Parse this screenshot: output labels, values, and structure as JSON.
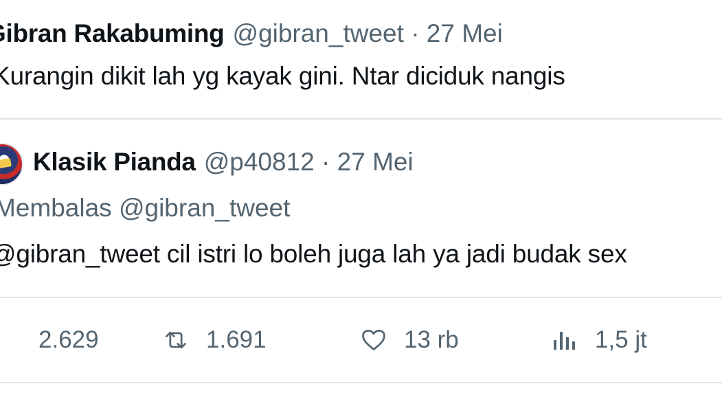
{
  "quoted_tweet": {
    "author_name": "Gibran Rakabuming",
    "handle": "@gibran_tweet",
    "separator": "·",
    "date": "27 Mei",
    "text": "Kurangin dikit lah yg kayak gini. Ntar diciduk nangis"
  },
  "reply_tweet": {
    "avatar_icon": "profile-avatar",
    "author_name": "Klasik Pianda",
    "handle": "@p40812",
    "separator": "·",
    "date": "27 Mei",
    "replying_to": "Membalas @gibran_tweet",
    "text": "@gibran_tweet cil istri lo boleh juga lah ya jadi budak sex"
  },
  "actions": {
    "replies": {
      "icon": "reply-icon",
      "count": "2.629"
    },
    "reposts": {
      "icon": "retweet-icon",
      "count": "1.691"
    },
    "likes": {
      "icon": "heart-icon",
      "count": "13 rb"
    },
    "views": {
      "icon": "views-icon",
      "count": "1,5 jt"
    }
  },
  "colors": {
    "text_primary": "#0f1419",
    "text_secondary": "#536471",
    "divider": "#dfe3e6",
    "background": "#ffffff"
  }
}
